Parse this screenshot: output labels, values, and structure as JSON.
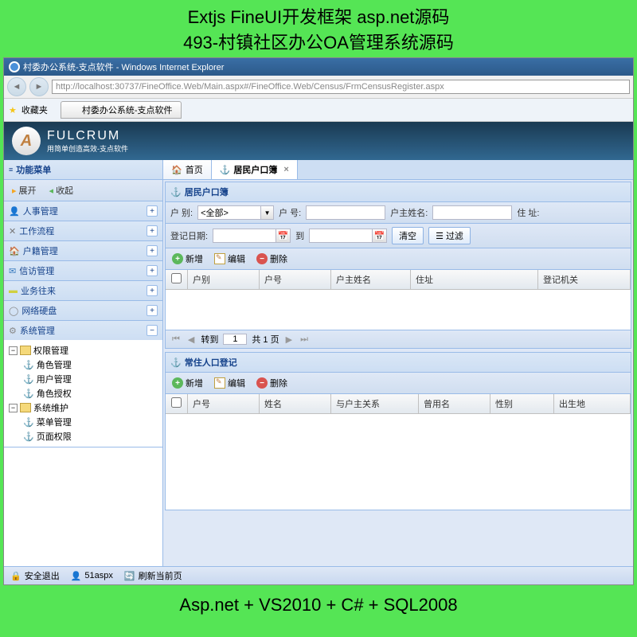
{
  "banner": {
    "line1": "Extjs FineUI开发框架 asp.net源码",
    "line2": "493-村镇社区办公OA管理系统源码",
    "bottom": "Asp.net + VS2010 + C# + SQL2008"
  },
  "browser": {
    "title": "村委办公系统-支点软件 - Windows Internet Explorer",
    "url": "http://localhost:30737/FineOffice.Web/Main.aspx#/FineOffice.Web/Census/FrmCensusRegister.aspx",
    "favorites": "收藏夹",
    "tab_title": "村委办公系统-支点软件"
  },
  "brand": {
    "name": "FULCRUM",
    "slogan": "用简单创造高效-支点软件"
  },
  "sidebar": {
    "title": "功能菜单",
    "expand": "展开",
    "collapse": "收起",
    "items": [
      {
        "label": "人事管理"
      },
      {
        "label": "工作流程"
      },
      {
        "label": "户籍管理"
      },
      {
        "label": "信访管理"
      },
      {
        "label": "业务往来"
      },
      {
        "label": "网络硬盘"
      },
      {
        "label": "系统管理"
      }
    ],
    "tree": {
      "perm": {
        "label": "权限管理",
        "children": [
          "角色管理",
          "用户管理",
          "角色授权"
        ]
      },
      "maint": {
        "label": "系统维护",
        "children": [
          "菜单管理",
          "页面权限"
        ]
      }
    }
  },
  "tabs": {
    "home": "首页",
    "census": "居民户口簿"
  },
  "panel1": {
    "title": "居民户口簿",
    "filters": {
      "type_label": "户    别:",
      "type_value": "<全部>",
      "num_label": "户    号:",
      "owner_label": "户主姓名:",
      "addr_label": "住    址:",
      "date_label": "登记日期:",
      "to": "到",
      "clear": "清空",
      "filter": "过滤"
    },
    "toolbar": {
      "add": "新增",
      "edit": "编辑",
      "del": "删除"
    },
    "columns": [
      "户别",
      "户号",
      "户主姓名",
      "住址",
      "登记机关"
    ],
    "pager": {
      "goto": "转到",
      "page": "1",
      "total": "共 1 页"
    }
  },
  "panel2": {
    "title": "常住人口登记",
    "toolbar": {
      "add": "新增",
      "edit": "编辑",
      "del": "删除"
    },
    "columns": [
      "户号",
      "姓名",
      "与户主关系",
      "曾用名",
      "性别",
      "出生地"
    ]
  },
  "statusbar": {
    "logout": "安全退出",
    "user": "51aspx",
    "refresh": "刷新当前页"
  }
}
